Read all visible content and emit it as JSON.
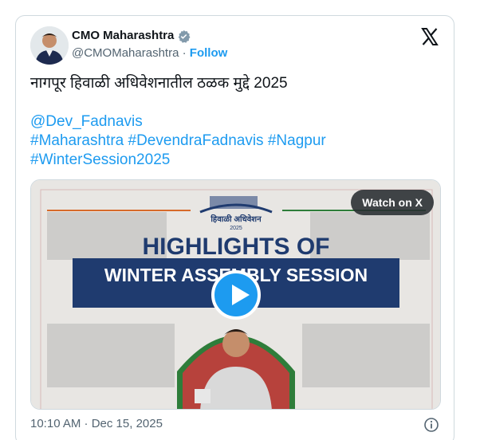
{
  "author": {
    "display_name": "CMO Maharashtra",
    "handle": "@CMOMaharashtra",
    "separator": "·",
    "follow_label": "Follow"
  },
  "tweet": {
    "title": "नागपूर हिवाळी अधिवेशनातील ठळक मुद्दे 2025",
    "mention": "@Dev_Fadnavis",
    "hashtags_line1": [
      "#Maharashtra",
      "#DevendraFadnavis",
      "#Nagpur"
    ],
    "hashtags_line2": [
      "#WinterSession2025"
    ]
  },
  "media": {
    "watch_label": "Watch on X",
    "emblem_caption": "हिवाळी अधिवेशन",
    "emblem_year": "2025",
    "headline_line1": "HIGHLIGHTS OF",
    "headline_line2": "WINTER ASSEMBLY SESSION",
    "colors": {
      "navy": "#1f3b6f",
      "saffron": "#d76a2a",
      "green": "#2e7d3a",
      "accent": "#1d9bf0"
    }
  },
  "footer": {
    "timestamp": "10:10 AM · Dec 15, 2025"
  }
}
